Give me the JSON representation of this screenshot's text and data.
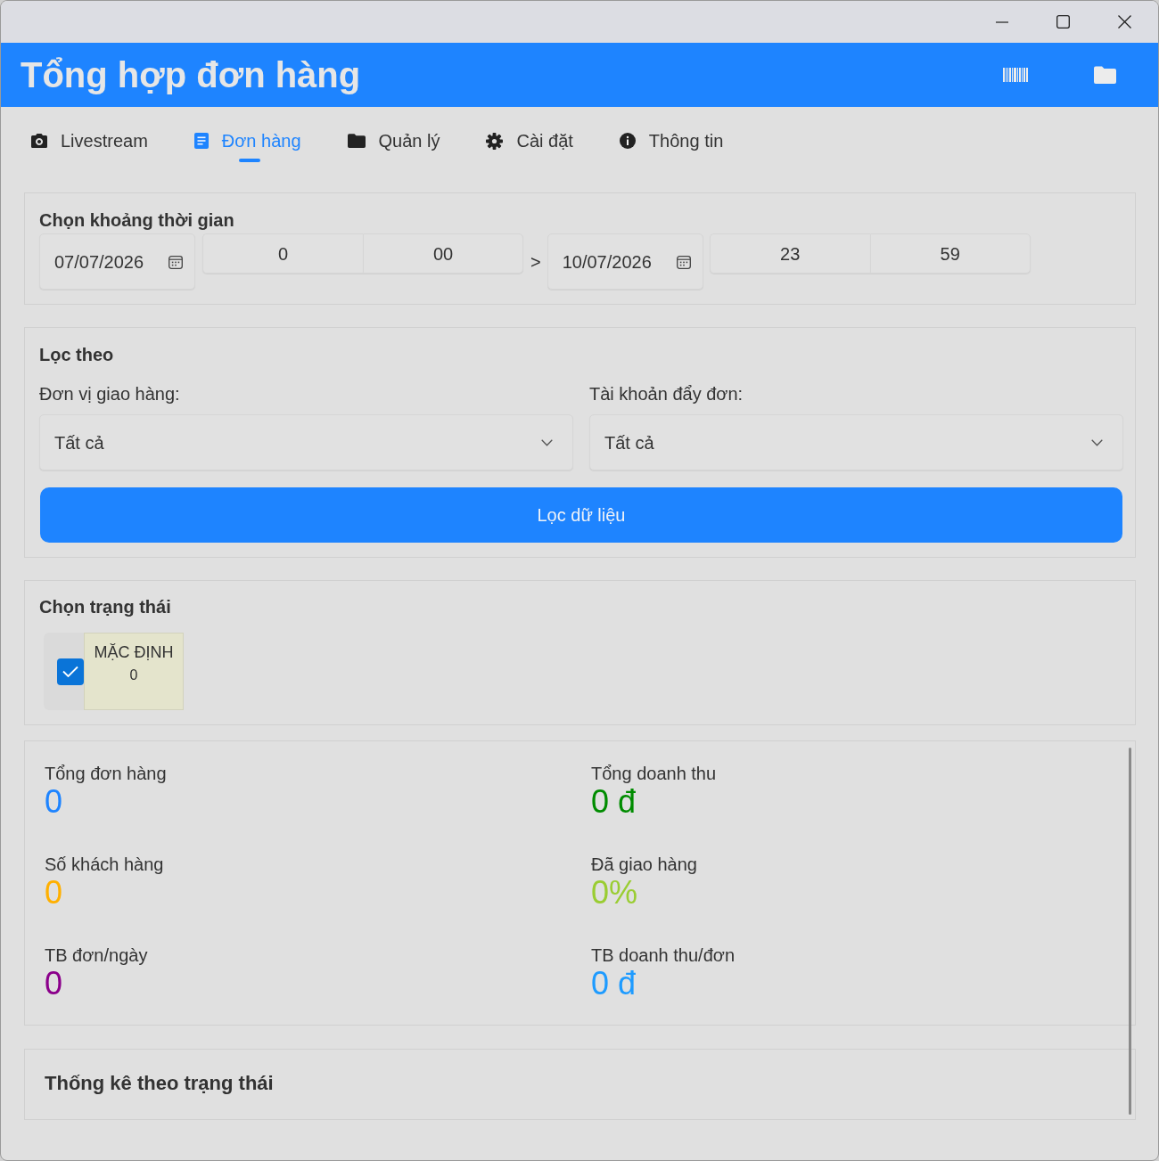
{
  "header": {
    "title": "Tổng hợp đơn hàng"
  },
  "tabs": [
    {
      "label": "Livestream",
      "selected": false
    },
    {
      "label": "Đơn hàng",
      "selected": true
    },
    {
      "label": "Quản lý",
      "selected": false
    },
    {
      "label": "Cài đặt",
      "selected": false
    },
    {
      "label": "Thông tin",
      "selected": false
    }
  ],
  "date_range": {
    "title": "Chọn khoảng thời gian",
    "from": {
      "date": "07/07/2026",
      "hour": "0",
      "minute": "00"
    },
    "separator": ">",
    "to": {
      "date": "10/07/2026",
      "hour": "23",
      "minute": "59"
    }
  },
  "filter": {
    "title": "Lọc theo",
    "fields": [
      {
        "label": "Đơn vị giao hàng:",
        "value": "Tất cả"
      },
      {
        "label": "Tài khoản đẩy đơn:",
        "value": "Tất cả"
      }
    ],
    "button": "Lọc dữ liệu"
  },
  "status_picker": {
    "title": "Chọn trạng thái",
    "statuses": [
      {
        "label": "MẶC ĐỊNH",
        "count": "0",
        "checked": true,
        "color": "#e4e4cc"
      }
    ]
  },
  "summary": {
    "stats": [
      {
        "label": "Tổng đơn hàng",
        "value": "0",
        "color": "#1e84ff"
      },
      {
        "label": "Tổng doanh thu",
        "value": "0 đ",
        "color": "#008c00"
      },
      {
        "label": "Số khách hàng",
        "value": "0",
        "color": "#ffb000"
      },
      {
        "label": "Đã giao hàng",
        "value": "0%",
        "color": "#9acd32"
      },
      {
        "label": "TB đơn/ngày",
        "value": "0",
        "color": "#8b008b"
      },
      {
        "label": "TB doanh thu/đơn",
        "value": "0 đ",
        "color": "#1e9bff"
      }
    ]
  },
  "status_stats": {
    "title": "Thống kê theo trạng thái"
  }
}
